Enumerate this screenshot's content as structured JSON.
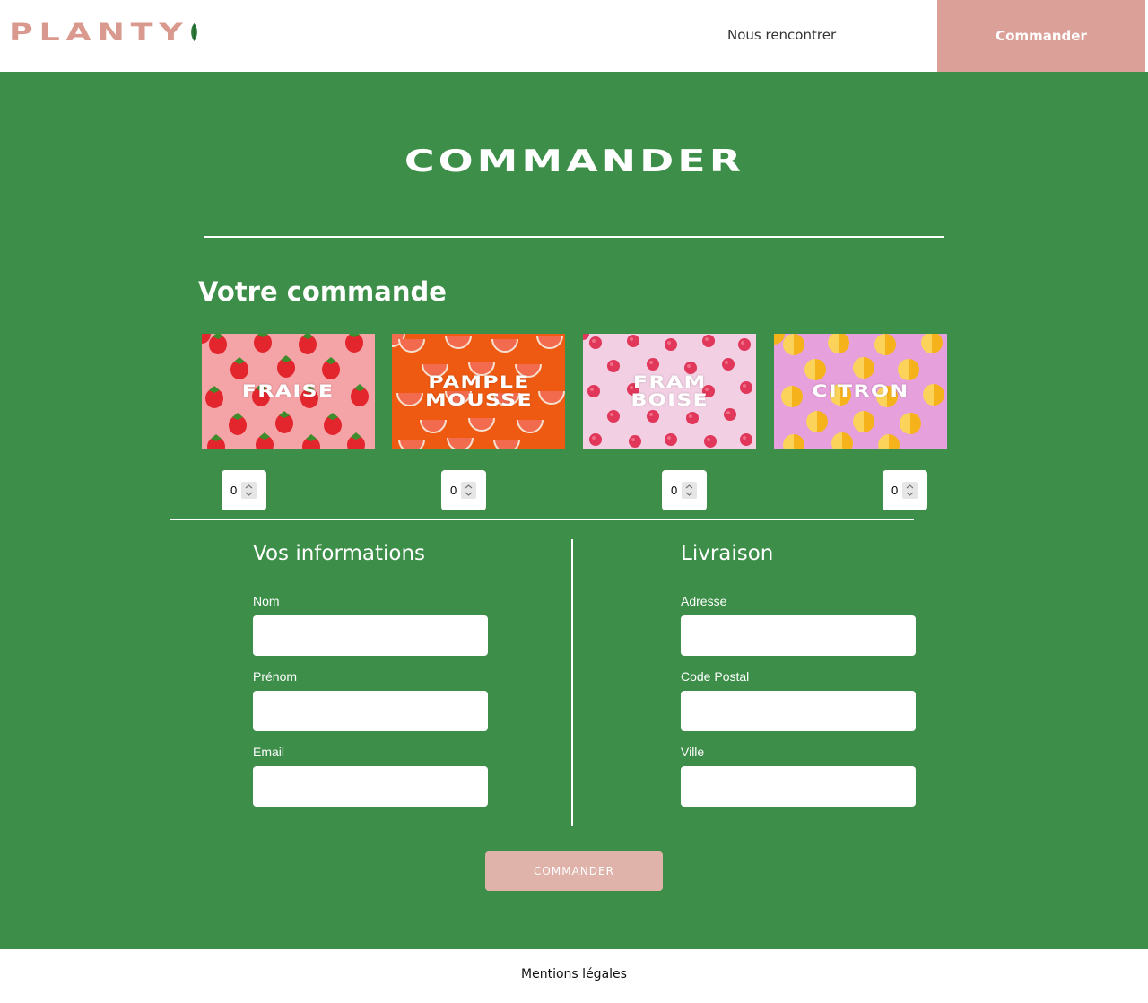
{
  "header": {
    "logo": "PLANTY",
    "nav_link": "Nous rencontrer",
    "nav_cta": "Commander"
  },
  "main": {
    "title": "COMMANDER",
    "order_title": "Votre commande",
    "products": [
      {
        "label": "FRAISE",
        "qty": "0"
      },
      {
        "label": "PAMPLE\nMOUSSE",
        "qty": "0"
      },
      {
        "label": "FRAM\nBOISE",
        "qty": "0"
      },
      {
        "label": "CITRON",
        "qty": "0"
      }
    ],
    "info": {
      "title": "Vos informations",
      "fields": [
        "Nom",
        "Prénom",
        "Email"
      ]
    },
    "delivery": {
      "title": "Livraison",
      "fields": [
        "Adresse",
        "Code Postal",
        "Ville"
      ]
    },
    "submit": "COMMANDER"
  },
  "footer": {
    "link": "Mentions légales"
  },
  "colors": {
    "green": "#3c8e48",
    "pink": "#dba097",
    "white": "#ffffff"
  }
}
